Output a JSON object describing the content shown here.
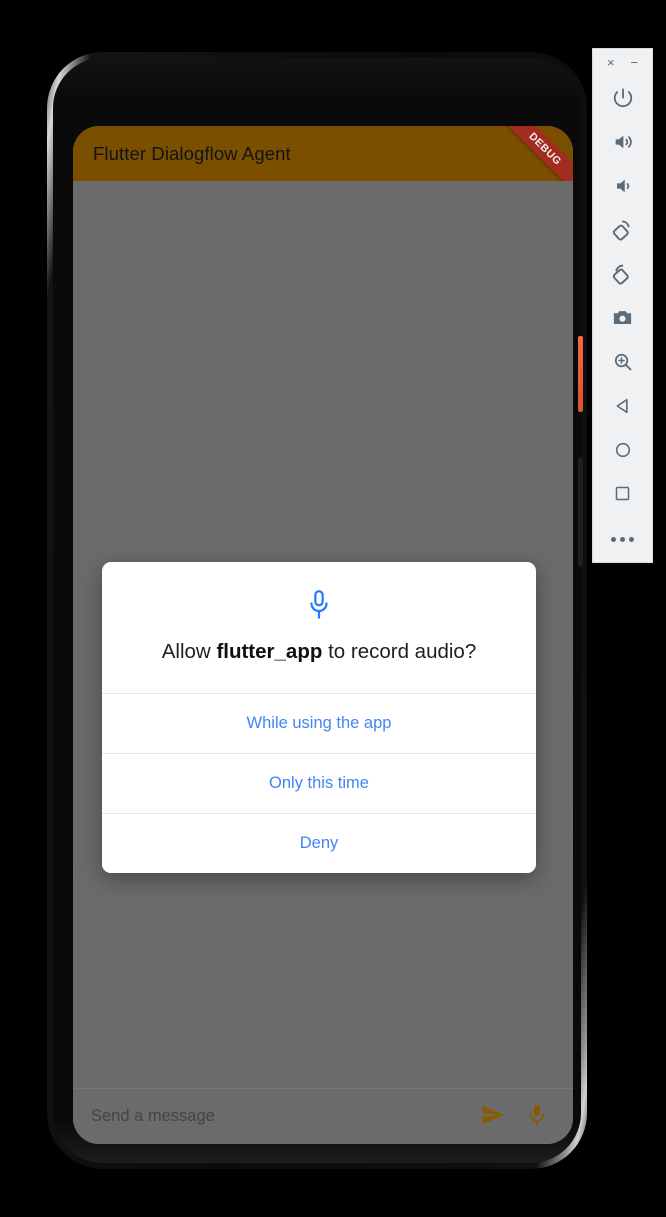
{
  "app": {
    "bar": {
      "title": "Flutter Dialogflow Agent",
      "bar_color": "#7a4f00",
      "debug_banner_label": "DEBUG",
      "debug_banner_color": "#a32c20"
    },
    "input_bar": {
      "placeholder": "Send a message",
      "value": "",
      "send_icon": "send-icon",
      "mic_icon": "microphone-icon",
      "icon_color": "#8a5a00"
    },
    "scrim_color": "#6b6b6b"
  },
  "dialog": {
    "icon": "microphone-icon",
    "icon_color": "#2979ff",
    "message_prefix": "Allow ",
    "message_app_name": "flutter_app",
    "message_suffix": " to record audio?",
    "options": [
      {
        "label": "While using the app",
        "name": "while-using-the-app"
      },
      {
        "label": "Only this time",
        "name": "only-this-time"
      },
      {
        "label": "Deny",
        "name": "deny"
      }
    ],
    "option_color": "#4285f4"
  },
  "emulator_toolbar": {
    "close_label": "×",
    "minimize_label": "−",
    "buttons": [
      {
        "name": "power-button",
        "icon": "power-icon"
      },
      {
        "name": "volume-up-button",
        "icon": "volume-up-icon"
      },
      {
        "name": "volume-down-button",
        "icon": "volume-down-icon"
      },
      {
        "name": "rotate-left-button",
        "icon": "rotate-left-icon"
      },
      {
        "name": "rotate-right-button",
        "icon": "rotate-right-icon"
      },
      {
        "name": "screenshot-button",
        "icon": "camera-icon"
      },
      {
        "name": "zoom-button",
        "icon": "zoom-in-icon"
      },
      {
        "name": "back-button",
        "icon": "back-triangle-icon"
      },
      {
        "name": "home-button",
        "icon": "home-circle-icon"
      },
      {
        "name": "overview-button",
        "icon": "overview-square-icon"
      },
      {
        "name": "more-button",
        "icon": "more-dots-icon"
      }
    ],
    "icon_color": "#5b6b77"
  },
  "device": {
    "power_button_color": "#e85d35",
    "frame_color": "#0b0b0b"
  }
}
